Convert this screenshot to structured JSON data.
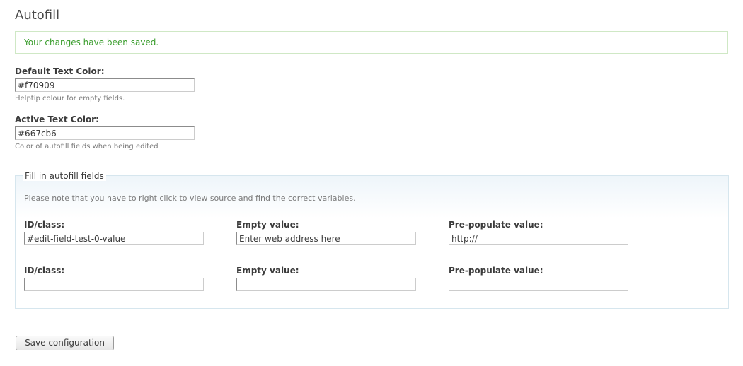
{
  "page": {
    "title": "Autofill"
  },
  "status": {
    "message": "Your changes have been saved."
  },
  "default_color": {
    "label": "Default Text Color:",
    "value": "#f70909",
    "description": "Helptip colour for empty fields."
  },
  "active_color": {
    "label": "Active Text Color:",
    "value": "#667cb6",
    "description": "Color of autofill fields when being edited"
  },
  "fieldset": {
    "legend": "Fill in autofill fields",
    "note": "Please note that you have to right click to view source and find the correct variables.",
    "rows": [
      {
        "id_label": "ID/class:",
        "id_value": "#edit-field-test-0-value",
        "empty_label": "Empty value:",
        "empty_value": "Enter web address here",
        "prepop_label": "Pre-populate value:",
        "prepop_value": "http://"
      },
      {
        "id_label": "ID/class:",
        "id_value": "",
        "empty_label": "Empty value:",
        "empty_value": "",
        "prepop_label": "Pre-populate value:",
        "prepop_value": ""
      }
    ]
  },
  "actions": {
    "save_label": "Save configuration"
  },
  "colors": {
    "status_text": "#3a9d2d",
    "status_border": "#cfe8c5",
    "fieldset_border": "#d6e6ee"
  }
}
